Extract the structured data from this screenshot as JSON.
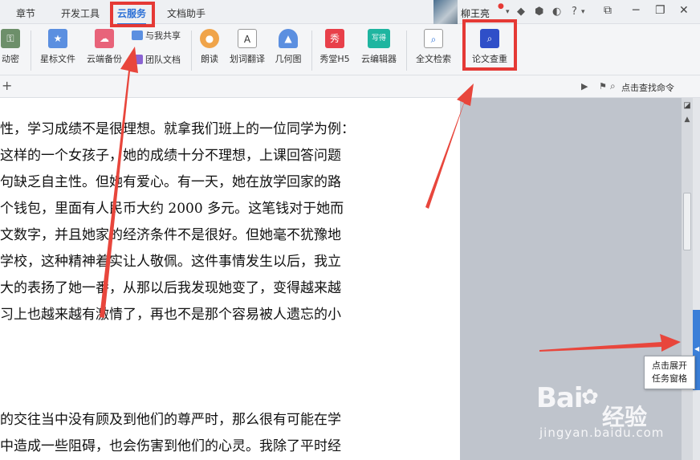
{
  "tabs": [
    "章节",
    "开发工具",
    "云服务",
    "文档助手"
  ],
  "user": {
    "name": "柳王亮",
    "help": "?"
  },
  "toolbar": {
    "encrypt": "动密",
    "star_files": "星标文件",
    "cloud_backup": "云端备份",
    "share_with_me": "与我共享",
    "team_docs": "团队文档",
    "read_aloud": "朗读",
    "word_translate": "划词翻译",
    "geometry": "几何图",
    "xiutang_h5": "秀堂H5",
    "cloud_editor": "云编辑器",
    "fulltext_search": "全文检索",
    "paper_check": "论文查重"
  },
  "icons": {
    "xiu": "秀",
    "xiede": "写得"
  },
  "subbar": {
    "find_command": "点击查找命令"
  },
  "document": {
    "lines": [
      "性，学习成绩不是很理想。就拿我们班上的一位同学为例：",
      "这样的一个女孩子，她的成绩十分不理想，上课回答问题",
      "句缺乏自主性。但她有爱心。有一天，她在放学回家的路",
      "个钱包，里面有人民币大约 2000 多元。这笔钱对于她而",
      "文数字，并且她家的经济条件不是很好。但她毫不犹豫地",
      "学校，这种精神着实让人敬佩。这件事情发生以后，我立",
      "大的表扬了她一番，从那以后我发现她变了，变得越来越",
      "习上也越来越有激情了，再也不是那个容易被人遗忘的小",
      "的交往当中没有顾及到他们的尊严时，那么很有可能在学",
      "中造成一些阻碍，也会伤害到他们的心灵。我除了平时经"
    ]
  },
  "tooltip": {
    "line1": "点击展开",
    "line2": "任务窗格"
  },
  "watermark": {
    "brand": "Bai",
    "brand2": "经验",
    "url": "jingyan.baidu.com"
  },
  "colors": {
    "accent": "#2a6fd6",
    "highlight": "#e53935",
    "task_tab": "#3b7fd8"
  }
}
